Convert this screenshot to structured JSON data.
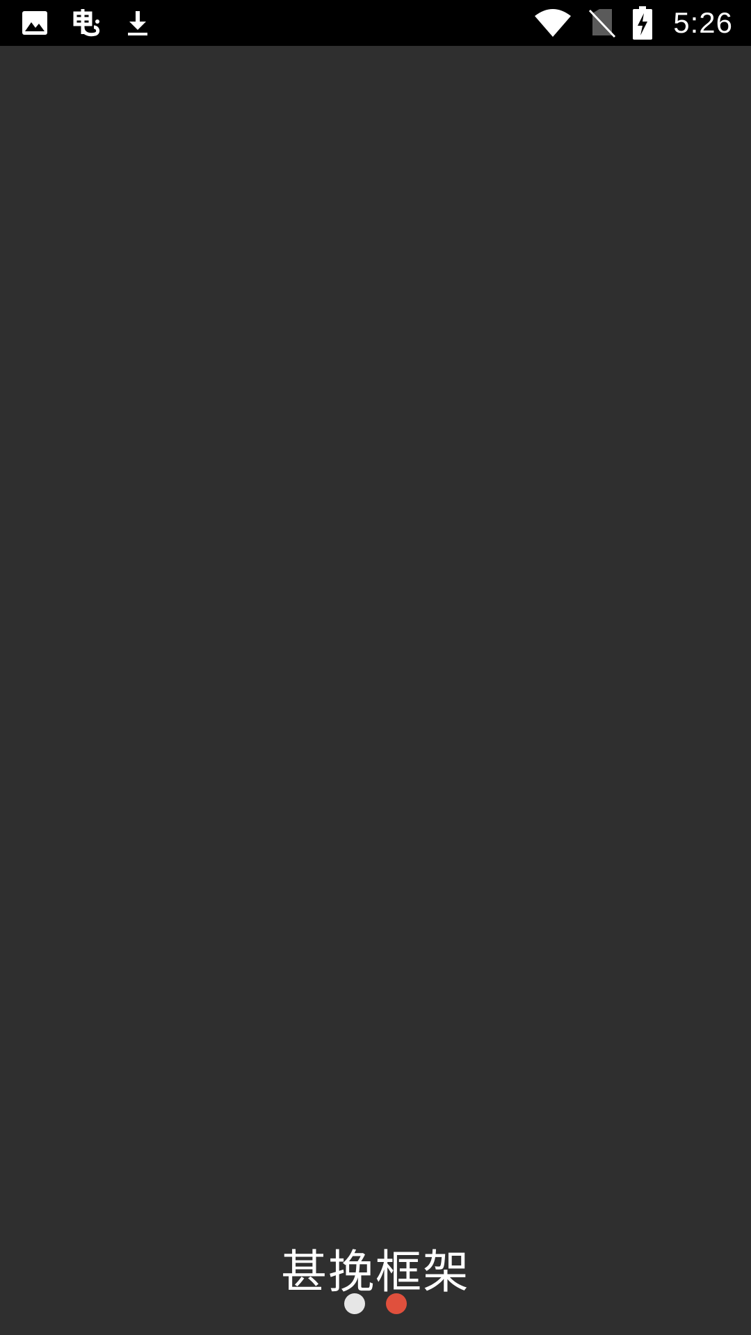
{
  "status_bar": {
    "time": "5:26",
    "left_icons": [
      "image-icon",
      "bug-icon",
      "download-icon"
    ],
    "right_icons": [
      "wifi-icon",
      "no-sim-icon",
      "battery-charging-icon"
    ]
  },
  "splash": {
    "slogan": "甚挽框架",
    "page_indicator": {
      "count": 2,
      "active_index": 1,
      "inactive_color": "#e6e6e6",
      "active_color": "#e0503d"
    }
  },
  "colors": {
    "background": "#2f2f2f",
    "status_bar": "#000000",
    "text": "#ffffff"
  }
}
